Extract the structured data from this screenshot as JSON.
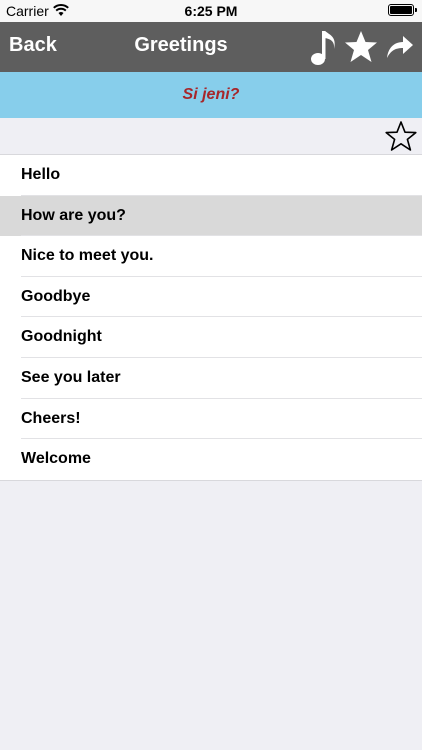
{
  "status_bar": {
    "carrier": "Carrier",
    "time": "6:25 PM"
  },
  "nav": {
    "back_label": "Back",
    "title": "Greetings"
  },
  "icons": {
    "music": "music-note-icon",
    "favorite": "star-icon",
    "share": "share-arrow-icon",
    "add_favorite": "star-outline-icon"
  },
  "translation": {
    "text": "Si jeni?",
    "color": "#a7262a",
    "background": "#87ceeb"
  },
  "phrases": [
    {
      "label": "Hello",
      "selected": false
    },
    {
      "label": "How are you?",
      "selected": true
    },
    {
      "label": "Nice to meet you.",
      "selected": false
    },
    {
      "label": "Goodbye",
      "selected": false
    },
    {
      "label": "Goodnight",
      "selected": false
    },
    {
      "label": "See you later",
      "selected": false
    },
    {
      "label": "Cheers!",
      "selected": false
    },
    {
      "label": "Welcome",
      "selected": false
    }
  ]
}
